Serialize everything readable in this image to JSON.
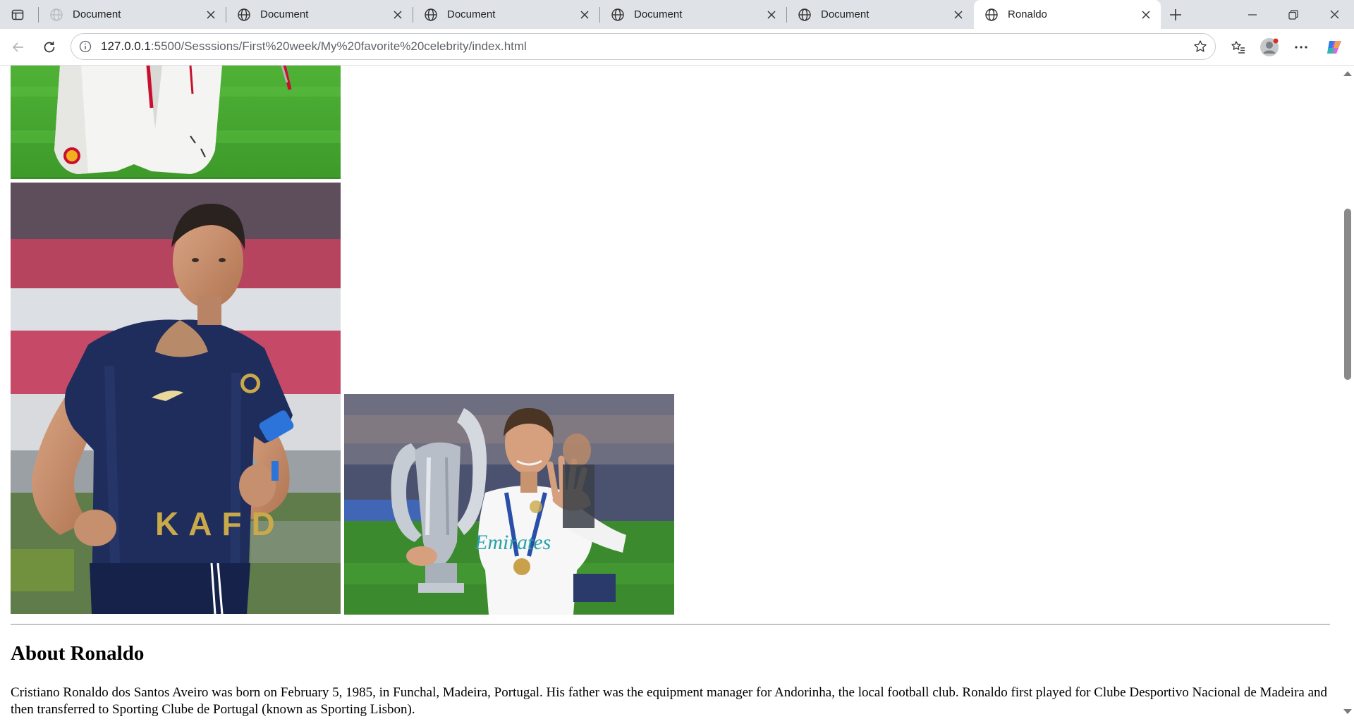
{
  "browser": {
    "tabs": [
      {
        "title": "Document",
        "active": false
      },
      {
        "title": "Document",
        "active": false
      },
      {
        "title": "Document",
        "active": false
      },
      {
        "title": "Document",
        "active": false
      },
      {
        "title": "Document",
        "active": false
      },
      {
        "title": "Ronaldo",
        "active": true
      }
    ],
    "address": {
      "host": "127.0.0.1",
      "path": ":5500/Sesssions/First%20week/My%20favorite%20celebrity/index.html"
    },
    "colors": {
      "tabstrip": "#dfe3e8",
      "active_tab": "#ffffff",
      "profile_notification_dot": "#d93025"
    }
  },
  "page": {
    "images": [
      {
        "subject": "Ronaldo in white Manchester United kit on grass (top portion, cropped by scroll)"
      },
      {
        "subject": "Ronaldo in navy Al Nassr KAFD jersey running"
      },
      {
        "subject": "Ronaldo in white Real Madrid kit holding Champions League trophy"
      }
    ],
    "jersey_text": "KAFD",
    "sponsor_text": "Emirates",
    "about": {
      "heading": "About Ronaldo",
      "paragraph": "Cristiano Ronaldo dos Santos Aveiro was born on February 5, 1985, in Funchal, Madeira, Portugal. His father was the equipment manager for Andorinha, the local football club. Ronaldo first played for Clube Desportivo Nacional de Madeira and then transferred to Sporting Clube de Portugal (known as Sporting Lisbon)."
    }
  }
}
